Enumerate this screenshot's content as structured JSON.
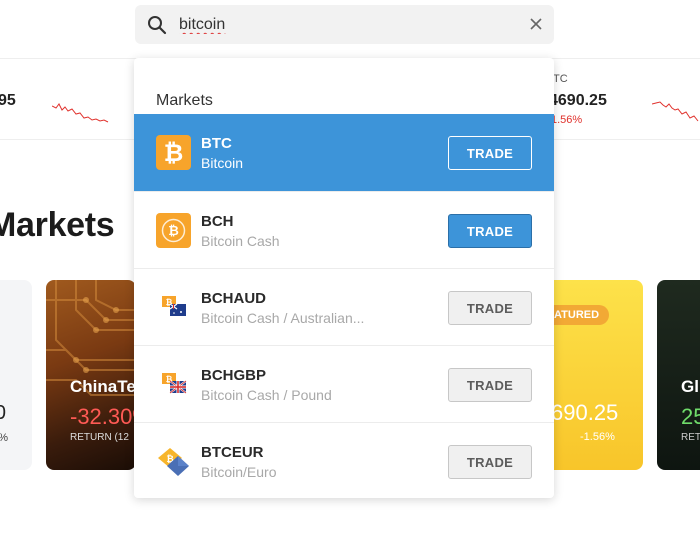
{
  "search": {
    "query": "bitcoin",
    "search_icon": "search-icon",
    "clear_icon": "close-icon"
  },
  "ticker": {
    "left_price": "95",
    "right_label": "TC",
    "right_price": "4690.25",
    "right_change": "1.56%"
  },
  "page": {
    "heading": "Markets"
  },
  "cards": {
    "partial_left": {
      "value": "0",
      "change": "%"
    },
    "china": {
      "name": "ChinaTe",
      "return_value": "-32.30%",
      "return_label": "RETURN (12"
    },
    "featured": {
      "badge": "FEATURED",
      "value": "690.25",
      "change": "-1.56%"
    },
    "right": {
      "name": "Gl",
      "return_value": "25",
      "return_label": "RET"
    }
  },
  "dropdown": {
    "heading": "Markets",
    "results": [
      {
        "symbol": "BTC",
        "name": "Bitcoin",
        "action": "TRADE",
        "icon": "bitcoin-icon",
        "selected": true
      },
      {
        "symbol": "BCH",
        "name": "Bitcoin Cash",
        "action": "TRADE",
        "icon": "bitcoin-cash-icon",
        "selected": false
      },
      {
        "symbol": "BCHAUD",
        "name": "Bitcoin Cash / Australian...",
        "action": "TRADE",
        "icon": "bch-aud-flag-icon",
        "selected": false
      },
      {
        "symbol": "BCHGBP",
        "name": "Bitcoin Cash / Pound",
        "action": "TRADE",
        "icon": "bch-gbp-flag-icon",
        "selected": false
      },
      {
        "symbol": "BTCEUR",
        "name": "Bitcoin/Euro",
        "action": "TRADE",
        "icon": "btc-eur-icon",
        "selected": false
      }
    ]
  },
  "colors": {
    "accent_blue": "#3d94d9",
    "bitcoin_orange": "#f7a42b",
    "negative_red": "#e0312c",
    "positive_green": "#6fdc6a"
  }
}
